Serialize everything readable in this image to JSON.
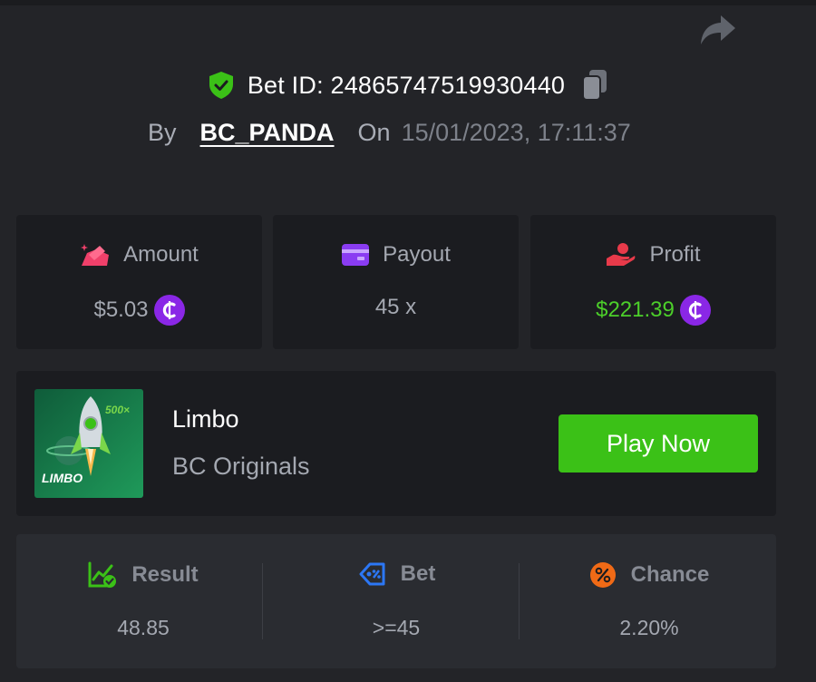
{
  "header": {
    "bet_id_label": "Bet ID: 24865747519930440",
    "by_label": "By",
    "username": "BC_PANDA",
    "on_label": "On",
    "datetime": "15/01/2023, 17:11:37"
  },
  "stats": [
    {
      "label": "Amount",
      "value": "$5.03",
      "icon": "amount-icon",
      "currency": "coin-icon"
    },
    {
      "label": "Payout",
      "value": "45 x",
      "icon": "wallet-icon"
    },
    {
      "label": "Profit",
      "value": "$221.39",
      "icon": "profit-hand-icon",
      "currency": "coin-icon"
    }
  ],
  "game": {
    "name": "Limbo",
    "provider": "BC Originals",
    "thumb_title": "LIMBO",
    "thumb_badge": "500×",
    "play_label": "Play Now"
  },
  "details": [
    {
      "label": "Result",
      "value": "48.85",
      "icon": "chart-check-icon"
    },
    {
      "label": "Bet",
      "value": ">=45",
      "icon": "ticket-icon"
    },
    {
      "label": "Chance",
      "value": "2.20%",
      "icon": "percent-icon"
    }
  ],
  "colors": {
    "background": "#232428",
    "card": "#1b1c20",
    "accent_green": "#3bc117",
    "profit_green": "#4ccf2a",
    "coin_purple": "#8a27e6",
    "amount_pink": "#f0406a",
    "profit_red": "#e83a4a",
    "payout_purple": "#8a3cf2",
    "bet_blue": "#2c77f5",
    "chance_orange": "#f06a16"
  }
}
